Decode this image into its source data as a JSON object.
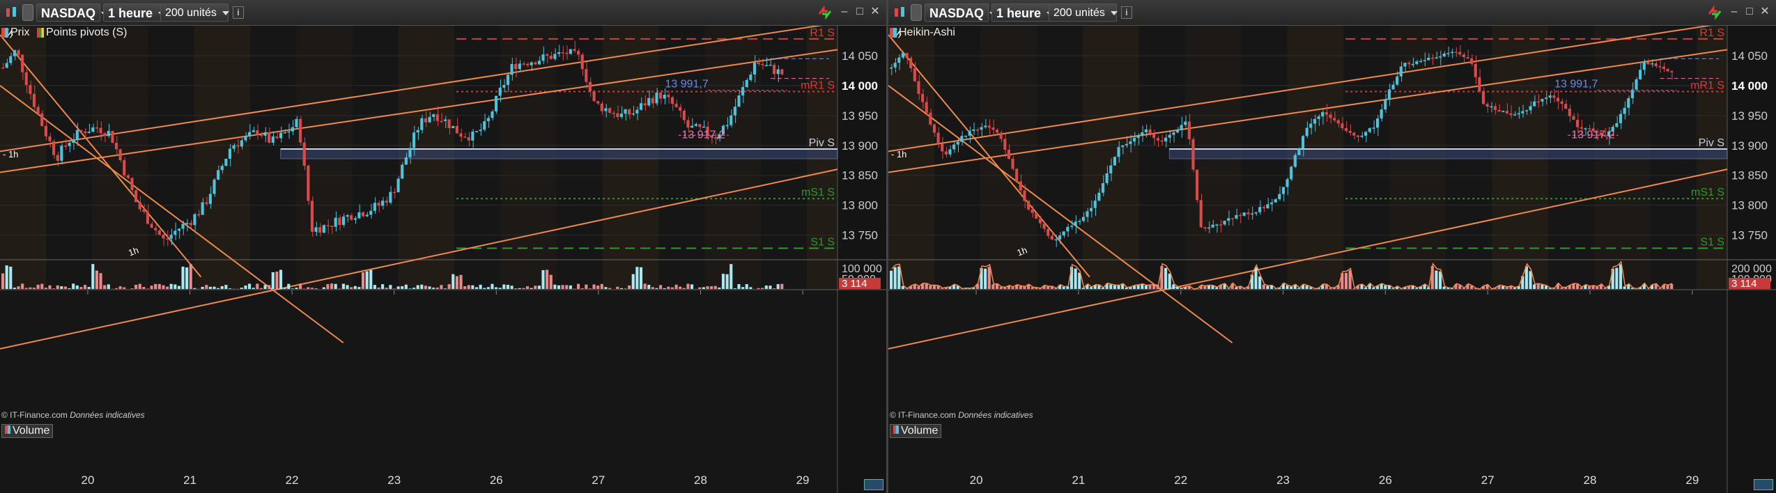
{
  "panels": [
    {
      "id": "left",
      "toolbar": {
        "symbol": "NASDAQ",
        "interval": "1 heure",
        "units": "200 unités",
        "info": "i"
      },
      "legend": {
        "series": [
          "Prix",
          "Points pivots (S)"
        ]
      },
      "credit": {
        "prefix": "© IT-Finance.com",
        "note": "Données indicatives"
      },
      "volume_label": "Volume",
      "volume_ticks": [
        "100 000",
        "50 000"
      ],
      "volume_last": "3 114"
    },
    {
      "id": "right",
      "toolbar": {
        "symbol": "NASDAQ",
        "interval": "1 heure",
        "units": "200 unités",
        "info": "i"
      },
      "legend": {
        "series": [
          "Heikin-Ashi"
        ]
      },
      "credit": {
        "prefix": "© IT-Finance.com",
        "note": "Données indicatives"
      },
      "volume_label": "Volume",
      "volume_ticks": [
        "200 000",
        "100 000"
      ],
      "volume_last": "3 114"
    }
  ],
  "colors": {
    "up": "#4fc3dc",
    "down": "#d94a4a",
    "trend": "#f08a4b",
    "r1": "#d93a3a",
    "s1": "#2e9a2e",
    "pivot": "#c8d0e8",
    "annotation": "#6a8ae8",
    "annotation2": "#e87aa8"
  },
  "chart_data": [
    {
      "type": "candlestick",
      "series_name": "Prix",
      "ylim": [
        13710,
        14100
      ],
      "y_ticks": [
        "14 050",
        "14 000",
        "13 950",
        "13 900",
        "13 850",
        "13 800",
        "13 750"
      ],
      "x_ticks": [
        "20",
        "21",
        "22",
        "23",
        "26",
        "27",
        "28",
        "29"
      ],
      "levels": [
        {
          "label": "R1 S",
          "value": 14078
        },
        {
          "label": "mR1 S",
          "value": 13990
        },
        {
          "label": "Piv S",
          "value": 13894
        },
        {
          "label": "mS1 S",
          "value": 13811
        },
        {
          "label": "S1 S",
          "value": 13728
        }
      ],
      "annotations": [
        "13 991,7",
        "13 917,2"
      ],
      "trendline_labels": [
        "1h",
        "- 1h",
        "1h"
      ],
      "volume_ylim": [
        0,
        110000
      ],
      "close_path": [
        14030,
        14060,
        13990,
        13930,
        13880,
        13910,
        13925,
        13930,
        13920,
        13860,
        13800,
        13770,
        13740,
        13760,
        13775,
        13800,
        13850,
        13900,
        13910,
        13925,
        13905,
        13920,
        13940,
        13760,
        13765,
        13775,
        13785,
        13790,
        13800,
        13820,
        13880,
        13935,
        13955,
        13940,
        13920,
        13915,
        13935,
        13990,
        14035,
        14040,
        14045,
        14050,
        14055,
        14045,
        13970,
        13960,
        13950,
        13955,
        13975,
        13985,
        13965,
        13930,
        13925,
        13915,
        13940,
        13990,
        14040,
        14030,
        14020
      ]
    },
    {
      "type": "candlestick",
      "series_name": "Heikin-Ashi",
      "ylim": [
        13710,
        14100
      ],
      "y_ticks": [
        "14 050",
        "14 000",
        "13 950",
        "13 900",
        "13 850",
        "13 800",
        "13 750"
      ],
      "x_ticks": [
        "20",
        "21",
        "22",
        "23",
        "26",
        "27",
        "28",
        "29"
      ],
      "levels": [
        {
          "label": "R1 S",
          "value": 14078
        },
        {
          "label": "mR1 S",
          "value": 13990
        },
        {
          "label": "Piv S",
          "value": 13894
        },
        {
          "label": "mS1 S",
          "value": 13811
        },
        {
          "label": "S1 S",
          "value": 13728
        }
      ],
      "annotations": [
        "13 991,7",
        "13 917,2"
      ],
      "trendline_labels": [
        "1h",
        "- 1h",
        "1h"
      ],
      "volume_ylim": [
        0,
        220000
      ],
      "close_path": [
        14030,
        14060,
        13990,
        13930,
        13880,
        13910,
        13925,
        13930,
        13920,
        13860,
        13800,
        13770,
        13740,
        13760,
        13775,
        13800,
        13850,
        13900,
        13910,
        13925,
        13905,
        13920,
        13940,
        13760,
        13765,
        13775,
        13785,
        13790,
        13800,
        13820,
        13880,
        13935,
        13955,
        13940,
        13920,
        13915,
        13935,
        13990,
        14035,
        14040,
        14045,
        14050,
        14055,
        14045,
        13970,
        13960,
        13950,
        13955,
        13975,
        13985,
        13965,
        13930,
        13925,
        13915,
        13940,
        13990,
        14040,
        14030,
        14020
      ]
    }
  ]
}
